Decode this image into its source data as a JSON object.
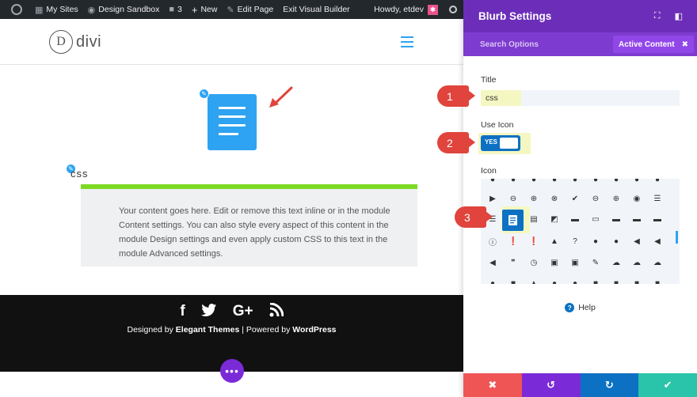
{
  "admin_bar": {
    "my_sites": "My Sites",
    "site_name": "Design Sandbox",
    "comments_count": "3",
    "new_label": "New",
    "edit_page": "Edit Page",
    "exit_builder": "Exit Visual Builder",
    "howdy": "Howdy, etdev"
  },
  "site": {
    "logo_letter": "D",
    "logo_text": "divi"
  },
  "blurb": {
    "title": "css",
    "body": "Your content goes here. Edit or remove this text inline or in the module Content settings. You can also style every aspect of this content in the module Design settings and even apply custom CSS to this text in the module Advanced settings."
  },
  "footer": {
    "designed_by": "Designed by",
    "elegant_themes": "Elegant Themes",
    "powered_by": "| Powered by",
    "wordpress": "WordPress",
    "social": [
      "f",
      "t",
      "G+",
      "rss"
    ]
  },
  "panel": {
    "title": "Blurb Settings",
    "search_placeholder": "Search Options",
    "active_filter": "Active Content",
    "title_label": "Title",
    "title_value": "css",
    "use_icon_label": "Use Icon",
    "toggle_value": "YES",
    "icon_label": "Icon",
    "help": "Help"
  },
  "steps": [
    "1",
    "2",
    "3"
  ],
  "colors": {
    "accent": "#2ea3f2",
    "panel_header": "#6c2eb9",
    "divider_green": "#7cda24",
    "cancel": "#ef5555",
    "undo": "#7b2ad8",
    "redo": "#0c71c3",
    "save": "#29c4a9"
  }
}
